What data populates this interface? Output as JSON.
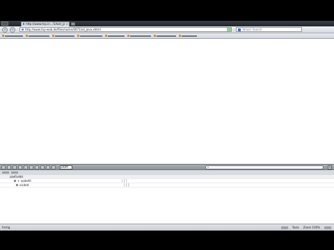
{
  "browser": {
    "tab": {
      "title": "http://www.tnp.in.../1/lost_java.xhtml"
    },
    "new_tab_label": "+",
    "nav": {
      "back_icon": "back-arrow-icon",
      "forward_icon": "forward-arrow-icon",
      "url": "http://www.tnp-web.de/files/sw/en/0671/sd_java.xhtml",
      "search_placeholder": "Yahoo! Search"
    },
    "bookmarks_count": 12
  },
  "devtools": {
    "select_label": "DOM",
    "close_label": "×",
    "search_icon": "search-icon",
    "rows": [
      {
        "name": "ukeFieldd",
        "value": "",
        "level": 1,
        "twisty": ""
      },
      {
        "name": "+ nodeAll",
        "value": "[ ]",
        "level": 2,
        "twisty": "+"
      },
      {
        "name": "visited",
        "value": "[ ]",
        "level": 3,
        "twisty": ""
      }
    ]
  },
  "status": {
    "left": "Fertig",
    "right_1": "Tools",
    "right_2": "Zoom 100%"
  }
}
